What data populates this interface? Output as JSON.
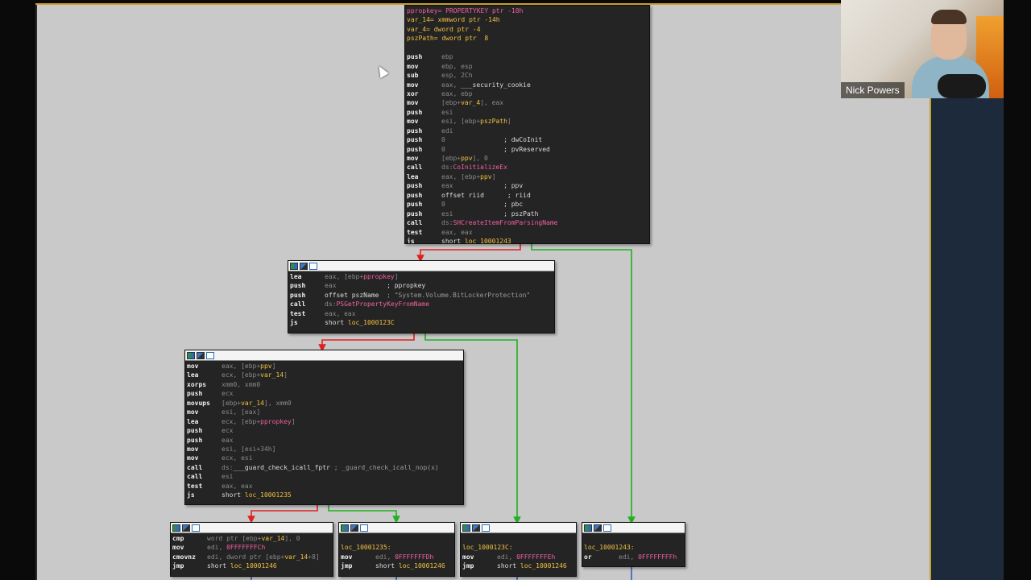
{
  "presenter": {
    "name": "Nick Powers"
  },
  "nodes": {
    "main": {
      "lines": [
        [
          {
            "c": "r",
            "v": "ppropkey= PROPERTYKEY ptr -10h"
          }
        ],
        [
          {
            "c": "y",
            "v": "var_14= xmmword ptr -14h"
          }
        ],
        [
          {
            "c": "y",
            "v": "var_4= dword ptr -4"
          }
        ],
        [
          {
            "c": "y",
            "v": "pszPath= dword ptr  8"
          }
        ],
        [],
        [
          {
            "c": "m",
            "v": "push"
          },
          {
            "c": "o",
            "v": "ebp"
          }
        ],
        [
          {
            "c": "m",
            "v": "mov"
          },
          {
            "c": "o",
            "v": "ebp, esp"
          }
        ],
        [
          {
            "c": "m",
            "v": "sub"
          },
          {
            "c": "o",
            "v": "esp, 2Ch"
          }
        ],
        [
          {
            "c": "m",
            "v": "mov"
          },
          {
            "c": "o",
            "v": "eax, "
          },
          {
            "c": "t",
            "v": "___security_cookie"
          }
        ],
        [
          {
            "c": "m",
            "v": "xor"
          },
          {
            "c": "o",
            "v": "eax, ebp"
          }
        ],
        [
          {
            "c": "m",
            "v": "mov"
          },
          {
            "c": "o",
            "v": "[ebp+"
          },
          {
            "c": "y",
            "v": "var_4"
          },
          {
            "c": "o",
            "v": "], eax"
          }
        ],
        [
          {
            "c": "m",
            "v": "push"
          },
          {
            "c": "o",
            "v": "esi"
          }
        ],
        [
          {
            "c": "m",
            "v": "mov"
          },
          {
            "c": "o",
            "v": "esi, [ebp+"
          },
          {
            "c": "y",
            "v": "pszPath"
          },
          {
            "c": "o",
            "v": "]"
          }
        ],
        [
          {
            "c": "m",
            "v": "push"
          },
          {
            "c": "o",
            "v": "edi"
          }
        ],
        [
          {
            "c": "m",
            "v": "push"
          },
          {
            "c": "o",
            "v": "0               "
          },
          {
            "c": "t",
            "v": "; dwCoInit"
          }
        ],
        [
          {
            "c": "m",
            "v": "push"
          },
          {
            "c": "o",
            "v": "0               "
          },
          {
            "c": "t",
            "v": "; pvReserved"
          }
        ],
        [
          {
            "c": "m",
            "v": "mov"
          },
          {
            "c": "o",
            "v": "[ebp+"
          },
          {
            "c": "y",
            "v": "ppv"
          },
          {
            "c": "o",
            "v": "], 0"
          }
        ],
        [
          {
            "c": "m",
            "v": "call"
          },
          {
            "c": "o",
            "v": "ds:"
          },
          {
            "c": "r",
            "v": "CoInitializeEx"
          }
        ],
        [
          {
            "c": "m",
            "v": "lea"
          },
          {
            "c": "o",
            "v": "eax, [ebp+"
          },
          {
            "c": "y",
            "v": "ppv"
          },
          {
            "c": "o",
            "v": "]"
          }
        ],
        [
          {
            "c": "m",
            "v": "push"
          },
          {
            "c": "o",
            "v": "eax             "
          },
          {
            "c": "t",
            "v": "; ppv"
          }
        ],
        [
          {
            "c": "m",
            "v": "push"
          },
          {
            "c": "t",
            "v": "offset riid      ; riid"
          }
        ],
        [
          {
            "c": "m",
            "v": "push"
          },
          {
            "c": "o",
            "v": "0               "
          },
          {
            "c": "t",
            "v": "; pbc"
          }
        ],
        [
          {
            "c": "m",
            "v": "push"
          },
          {
            "c": "o",
            "v": "esi             "
          },
          {
            "c": "t",
            "v": "; pszPath"
          }
        ],
        [
          {
            "c": "m",
            "v": "call"
          },
          {
            "c": "o",
            "v": "ds:"
          },
          {
            "c": "r",
            "v": "SHCreateItemFromParsingName"
          }
        ],
        [
          {
            "c": "m",
            "v": "test"
          },
          {
            "c": "o",
            "v": "eax, eax"
          }
        ],
        [
          {
            "c": "m",
            "v": "js"
          },
          {
            "c": "t",
            "v": "short "
          },
          {
            "c": "lbl",
            "v": "loc_10001243"
          }
        ]
      ]
    },
    "n2": {
      "lines": [
        [
          {
            "c": "m",
            "v": "lea"
          },
          {
            "c": "o",
            "v": "eax, [ebp+"
          },
          {
            "c": "r",
            "v": "ppropkey"
          },
          {
            "c": "o",
            "v": "]"
          }
        ],
        [
          {
            "c": "m",
            "v": "push"
          },
          {
            "c": "o",
            "v": "eax             "
          },
          {
            "c": "t",
            "v": "; ppropkey"
          }
        ],
        [
          {
            "c": "m",
            "v": "push"
          },
          {
            "c": "t",
            "v": "offset pszName  "
          },
          {
            "c": "c",
            "v": "; \"System.Volume.BitLockerProtection\""
          }
        ],
        [
          {
            "c": "m",
            "v": "call"
          },
          {
            "c": "o",
            "v": "ds:"
          },
          {
            "c": "r",
            "v": "PSGetPropertyKeyFromName"
          }
        ],
        [
          {
            "c": "m",
            "v": "test"
          },
          {
            "c": "o",
            "v": "eax, eax"
          }
        ],
        [
          {
            "c": "m",
            "v": "js"
          },
          {
            "c": "t",
            "v": "short "
          },
          {
            "c": "lbl",
            "v": "loc_1000123C"
          }
        ]
      ]
    },
    "n3": {
      "lines": [
        [
          {
            "c": "m",
            "v": "mov"
          },
          {
            "c": "o",
            "v": "eax, [ebp+"
          },
          {
            "c": "y",
            "v": "ppv"
          },
          {
            "c": "o",
            "v": "]"
          }
        ],
        [
          {
            "c": "m",
            "v": "lea"
          },
          {
            "c": "o",
            "v": "ecx, [ebp+"
          },
          {
            "c": "y",
            "v": "var_14"
          },
          {
            "c": "o",
            "v": "]"
          }
        ],
        [
          {
            "c": "m",
            "v": "xorps"
          },
          {
            "c": "o",
            "v": "xmm0, xmm0"
          }
        ],
        [
          {
            "c": "m",
            "v": "push"
          },
          {
            "c": "o",
            "v": "ecx"
          }
        ],
        [
          {
            "c": "m",
            "v": "movups"
          },
          {
            "c": "o",
            "v": "[ebp+"
          },
          {
            "c": "y",
            "v": "var_14"
          },
          {
            "c": "o",
            "v": "], xmm0"
          }
        ],
        [
          {
            "c": "m",
            "v": "mov"
          },
          {
            "c": "o",
            "v": "esi, [eax]"
          }
        ],
        [
          {
            "c": "m",
            "v": "lea"
          },
          {
            "c": "o",
            "v": "ecx, [ebp+"
          },
          {
            "c": "r",
            "v": "ppropkey"
          },
          {
            "c": "o",
            "v": "]"
          }
        ],
        [
          {
            "c": "m",
            "v": "push"
          },
          {
            "c": "o",
            "v": "ecx"
          }
        ],
        [
          {
            "c": "m",
            "v": "push"
          },
          {
            "c": "o",
            "v": "eax"
          }
        ],
        [
          {
            "c": "m",
            "v": "mov"
          },
          {
            "c": "o",
            "v": "esi, [esi+34h]"
          }
        ],
        [
          {
            "c": "m",
            "v": "mov"
          },
          {
            "c": "o",
            "v": "ecx, esi"
          }
        ],
        [
          {
            "c": "m",
            "v": "call"
          },
          {
            "c": "o",
            "v": "ds:"
          },
          {
            "c": "t",
            "v": "___guard_check_icall_fptr "
          },
          {
            "c": "c",
            "v": "; _guard_check_icall_nop(x)"
          }
        ],
        [
          {
            "c": "m",
            "v": "call"
          },
          {
            "c": "o",
            "v": "esi"
          }
        ],
        [
          {
            "c": "m",
            "v": "test"
          },
          {
            "c": "o",
            "v": "eax, eax"
          }
        ],
        [
          {
            "c": "m",
            "v": "js"
          },
          {
            "c": "t",
            "v": "short "
          },
          {
            "c": "lbl",
            "v": "loc_10001235"
          }
        ]
      ]
    },
    "b1": {
      "lines": [
        [
          {
            "c": "m",
            "v": "cmp"
          },
          {
            "c": "o",
            "v": "word ptr [ebp+"
          },
          {
            "c": "y",
            "v": "var_14"
          },
          {
            "c": "o",
            "v": "], 0"
          }
        ],
        [
          {
            "c": "m",
            "v": "mov"
          },
          {
            "c": "o",
            "v": "edi, "
          },
          {
            "c": "r",
            "v": "0FFFFFFFCh"
          }
        ],
        [
          {
            "c": "m",
            "v": "cmovnz"
          },
          {
            "c": "o",
            "v": "edi, dword ptr [ebp+"
          },
          {
            "c": "y",
            "v": "var_14"
          },
          {
            "c": "o",
            "v": "+8]"
          }
        ],
        [
          {
            "c": "m",
            "v": "jmp"
          },
          {
            "c": "t",
            "v": "short "
          },
          {
            "c": "lbl",
            "v": "loc_10001246"
          }
        ]
      ]
    },
    "b2": {
      "lines": [
        [],
        [
          {
            "c": "lbl",
            "v": "loc_10001235:"
          }
        ],
        [
          {
            "c": "m",
            "v": "mov"
          },
          {
            "c": "o",
            "v": "edi, "
          },
          {
            "c": "r",
            "v": "0FFFFFFFDh"
          }
        ],
        [
          {
            "c": "m",
            "v": "jmp"
          },
          {
            "c": "t",
            "v": "short "
          },
          {
            "c": "lbl",
            "v": "loc_10001246"
          }
        ]
      ]
    },
    "b3": {
      "lines": [
        [],
        [
          {
            "c": "lbl",
            "v": "loc_1000123C:"
          }
        ],
        [
          {
            "c": "m",
            "v": "mov"
          },
          {
            "c": "o",
            "v": "edi, "
          },
          {
            "c": "r",
            "v": "0FFFFFFFEh"
          }
        ],
        [
          {
            "c": "m",
            "v": "jmp"
          },
          {
            "c": "t",
            "v": "short "
          },
          {
            "c": "lbl",
            "v": "loc_10001246"
          }
        ]
      ]
    },
    "b4": {
      "lines": [
        [],
        [
          {
            "c": "lbl",
            "v": "loc_10001243:"
          }
        ],
        [
          {
            "c": "m",
            "v": "or"
          },
          {
            "c": "o",
            "v": "edi, "
          },
          {
            "c": "r",
            "v": "0FFFFFFFFh"
          }
        ]
      ]
    }
  }
}
